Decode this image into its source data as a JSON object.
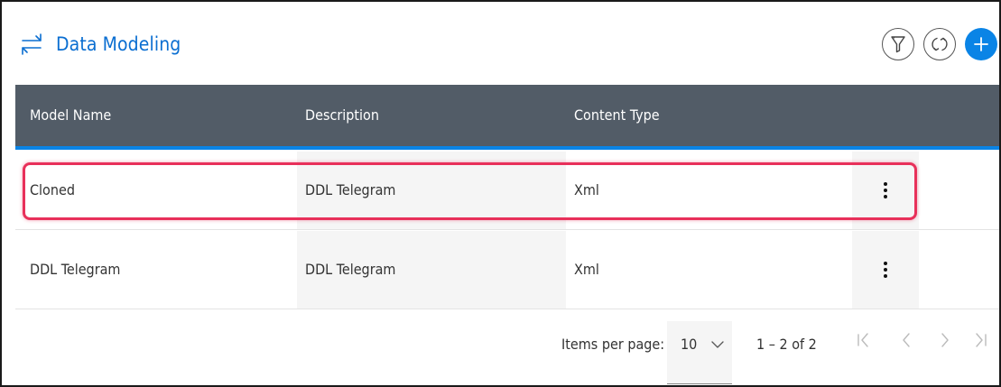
{
  "header": {
    "title": "Data Modeling",
    "title_icon": "swap-arrows-icon",
    "buttons": [
      {
        "name": "filter-button",
        "icon": "filter-icon"
      },
      {
        "name": "refresh-button",
        "icon": "refresh-icon"
      },
      {
        "name": "add-button",
        "icon": "plus-icon"
      }
    ],
    "accent_color": "#0a84e6"
  },
  "table": {
    "columns": [
      "Model Name",
      "Description",
      "Content Type"
    ],
    "rows": [
      {
        "model_name": "Cloned",
        "description": "DDL Telegram",
        "content_type": "Xml",
        "menu_icon": "more-vertical-icon",
        "highlighted": true
      },
      {
        "model_name": "DDL Telegram",
        "description": "DDL Telegram",
        "content_type": "Xml",
        "menu_icon": "more-vertical-icon",
        "highlighted": false
      }
    ],
    "header_bg": "#525c67",
    "highlight_color": "#e8305a"
  },
  "pagination": {
    "items_per_page_label": "Items per page:",
    "items_per_page_value": "10",
    "range_text": "1 – 2 of 2",
    "nav_icons": [
      "first-page-icon",
      "prev-page-icon",
      "next-page-icon",
      "last-page-icon"
    ]
  }
}
